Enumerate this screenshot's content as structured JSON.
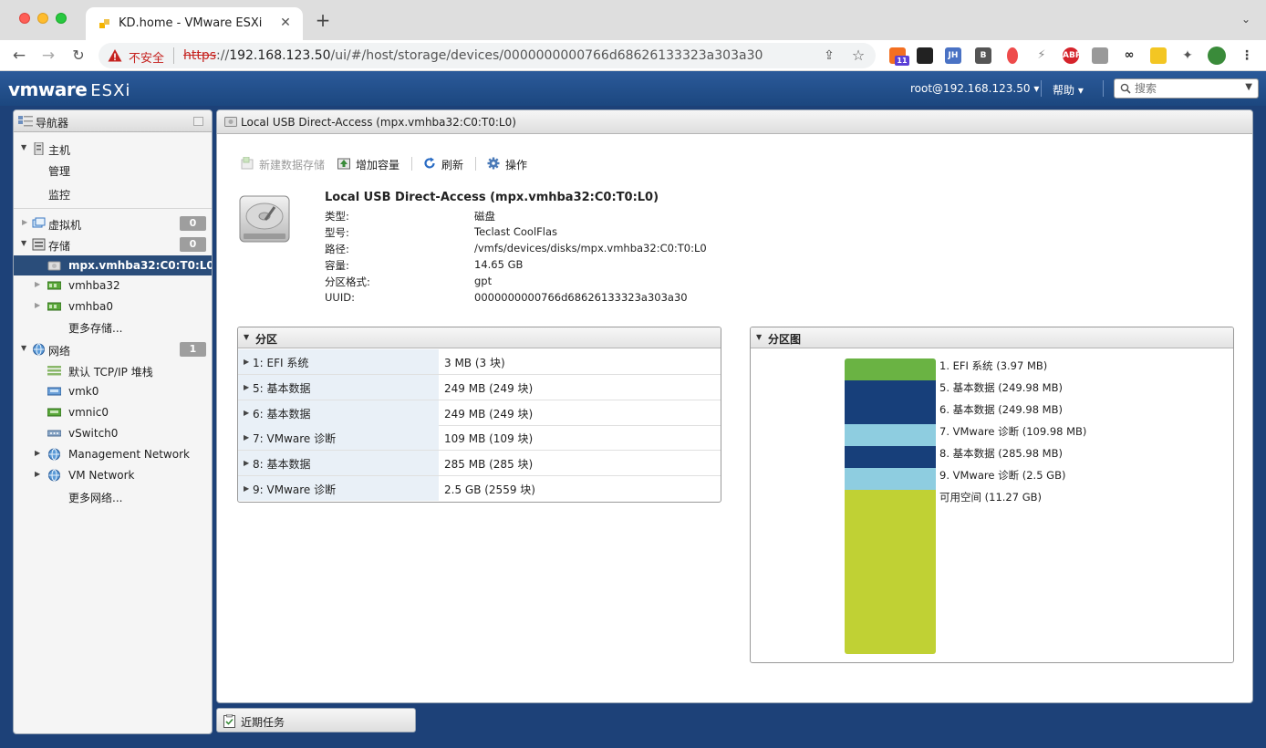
{
  "browser": {
    "tab_title": "KD.home - VMware ESXi",
    "insecure_label": "不安全",
    "url_scheme": "https",
    "url_sep": "://",
    "url_host": "192.168.123.50",
    "url_path": "/ui/#/host/storage/devices/0000000000766d68626133323a303a30",
    "extension_badge": "11"
  },
  "header": {
    "brand_vm": "vmware",
    "brand_product": "ESXi",
    "user": "root@192.168.123.50",
    "help": "帮助",
    "search_placeholder": "搜索"
  },
  "navigator": {
    "title": "导航器",
    "host": "主机",
    "host_children": [
      "管理",
      "监控"
    ],
    "vms": {
      "label": "虚拟机",
      "count": "0"
    },
    "storage": {
      "label": "存储",
      "count": "0"
    },
    "storage_children": [
      "mpx.vmhba32:C0:T0:L0",
      "vmhba32",
      "vmhba0",
      "更多存储..."
    ],
    "network": {
      "label": "网络",
      "count": "1"
    },
    "network_children": [
      "默认 TCP/IP 堆栈",
      "vmk0",
      "vmnic0",
      "vSwitch0",
      "Management Network",
      "VM Network",
      "更多网络..."
    ]
  },
  "main": {
    "title": "Local USB Direct-Access (mpx.vmhba32:C0:T0:L0)",
    "toolbar": {
      "new_datastore": "新建数据存储",
      "increase_capacity": "增加容量",
      "refresh": "刷新",
      "actions": "操作"
    },
    "device_title": "Local USB Direct-Access (mpx.vmhba32:C0:T0:L0)",
    "properties": [
      {
        "key": "类型:",
        "value": "磁盘"
      },
      {
        "key": "型号:",
        "value": "Teclast CoolFlas"
      },
      {
        "key": "路径:",
        "value": "/vmfs/devices/disks/mpx.vmhba32:C0:T0:L0"
      },
      {
        "key": "容量:",
        "value": "14.65 GB"
      },
      {
        "key": "分区格式:",
        "value": "gpt"
      },
      {
        "key": "UUID:",
        "value": "0000000000766d68626133323a303a30"
      }
    ],
    "partitions": {
      "title": "分区",
      "rows": [
        {
          "name": "1: EFI 系统",
          "size": "3 MB (3 块)"
        },
        {
          "name": "5: 基本数据",
          "size": "249 MB (249 块)"
        },
        {
          "name": "6: 基本数据",
          "size": "249 MB (249 块)"
        },
        {
          "name": "7: VMware 诊断",
          "size": "109 MB (109 块)"
        },
        {
          "name": "8: 基本数据",
          "size": "285 MB (285 块)"
        },
        {
          "name": "9: VMware 诊断",
          "size": "2.5 GB (2559 块)"
        }
      ]
    },
    "partition_map": {
      "title": "分区图",
      "segments": [
        {
          "label": "1. EFI 系统   (3.97 MB)",
          "color": "#6ab343"
        },
        {
          "label": "5. 基本数据   (249.98 MB)",
          "color": "#173f7a"
        },
        {
          "label": "6. 基本数据   (249.98 MB)",
          "color": "#173f7a"
        },
        {
          "label": "7. VMware 诊断   (109.98 MB)",
          "color": "#8ecde0"
        },
        {
          "label": "8. 基本数据   (285.98 MB)",
          "color": "#173f7a"
        },
        {
          "label": "9. VMware 诊断   (2.5 GB)",
          "color": "#8ecde0"
        },
        {
          "label": "可用空间   (11.27 GB)",
          "color": "#c0d134"
        }
      ]
    }
  },
  "recent_tasks": "近期任务",
  "colors": {
    "header_blue": "#1c477f",
    "selected_nav": "#2a4d7a",
    "partition_name_bg": "#e9f0f7"
  }
}
